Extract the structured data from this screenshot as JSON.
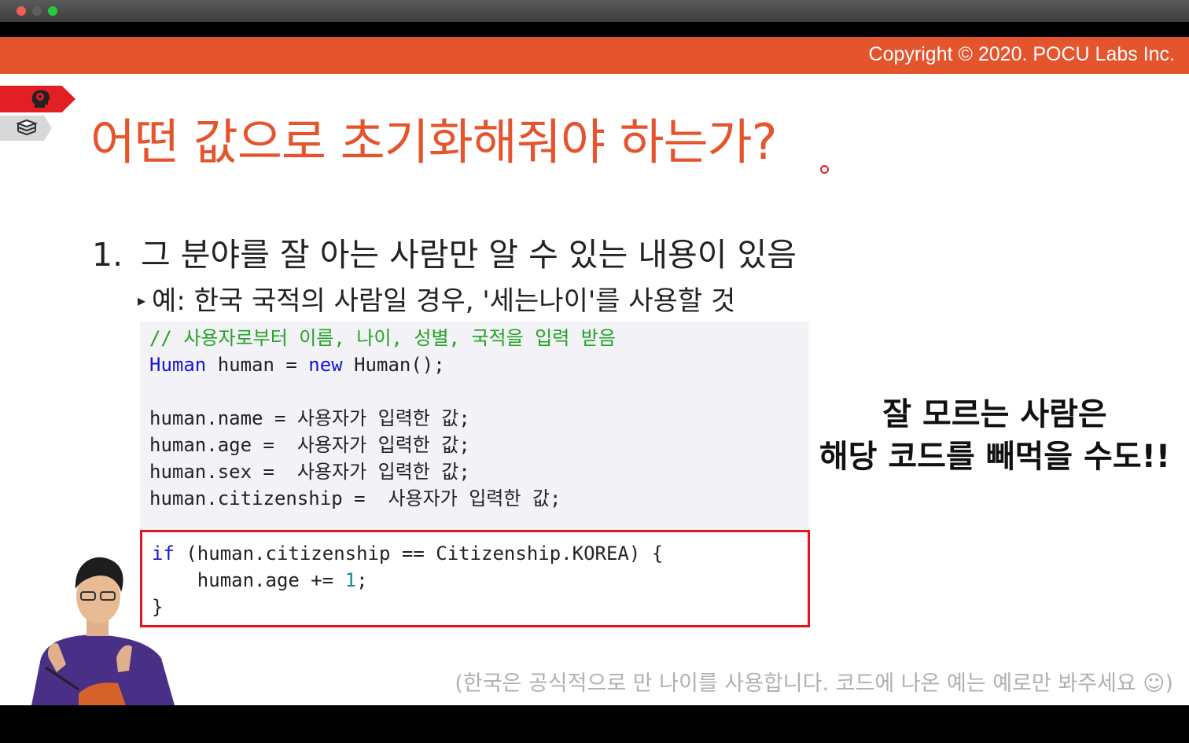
{
  "window": {
    "controls": [
      "close",
      "minimize",
      "maximize"
    ]
  },
  "slide": {
    "copyright": "Copyright © 2020. POCU Labs Inc.",
    "side_tags": {
      "tag1_icon": "brain-head-icon",
      "tag2_icon": "book-stack-icon"
    },
    "title": "어떤 값으로 초기화해줘야 하는가?",
    "point1": {
      "number": "1.",
      "text": "그 분야를 잘 아는 사람만 알 수 있는 내용이 있음"
    },
    "sub1": {
      "bullet": "▸",
      "text": "예: 한국 국적의 사람일 경우, '세는나이'를 사용할 것"
    },
    "code": {
      "comment": "// 사용자로부터 이름, 나이, 성별, 국적을 입력 받음",
      "decl_type": "Human",
      "decl_rest1": " human = ",
      "decl_new": "new",
      "decl_rest2": " Human();",
      "assign_name": "human.name = 사용자가 입력한 값;",
      "assign_age": "human.age =  사용자가 입력한 값;",
      "assign_sex": "human.sex =  사용자가 입력한 값;",
      "assign_citizenship": "human.citizenship =  사용자가 입력한 값;",
      "if_kw": "if",
      "if_rest": " (human.citizenship == Citizenship.KOREA) {",
      "inc_pre": "    human.age += ",
      "inc_num": "1",
      "inc_post": ";",
      "close_brace": "}"
    },
    "note": {
      "line1": "잘 모르는 사람은",
      "line2": "해당 코드를 빼먹을 수도!!"
    },
    "footnote": "(한국은 공식적으로 만 나이를 사용합니다. 코드에 나온 예는 예로만 봐주세요 ☺)",
    "colors": {
      "accent": "#e5552d",
      "highlight_box": "#e3161d",
      "comment": "#22a322",
      "keyword": "#1515d0"
    }
  }
}
